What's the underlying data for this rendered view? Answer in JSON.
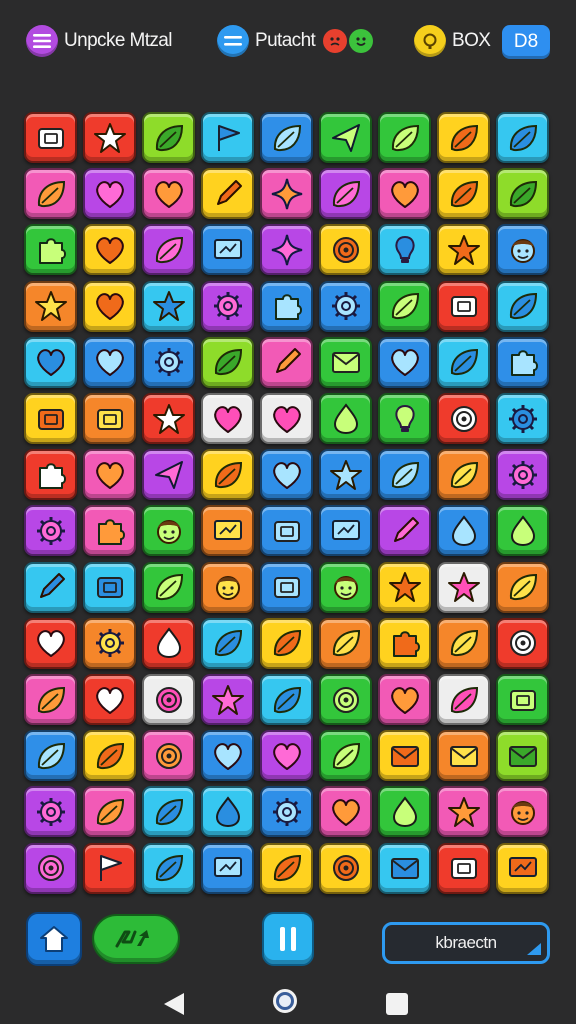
{
  "header": {
    "left_label": "Unpcke Mtzal",
    "middle_label": "Putacht",
    "coins_label": "BOX",
    "level_label": "D8"
  },
  "colors": {
    "red": "#ef3b2c",
    "yellow": "#ffd21f",
    "green": "#33c63b",
    "blue": "#2f8fe8",
    "cyan": "#36c7f0",
    "pink": "#f25ab6",
    "purple": "#b847e6",
    "orange": "#f5862a",
    "lime": "#8edc2a",
    "white": "#eeeeee",
    "lightgreen": "#9ce65a",
    "magenta": "#e448e0"
  },
  "board": {
    "rows": [
      [
        [
          "red",
          "box"
        ],
        [
          "red",
          "star"
        ],
        [
          "lime",
          "leaf"
        ],
        [
          "cyan",
          "flag"
        ],
        [
          "blue",
          "leaf"
        ],
        [
          "green",
          "arrow"
        ],
        [
          "green",
          "leaf"
        ],
        [
          "yellow",
          "leaf"
        ],
        [
          "cyan",
          "leaf"
        ]
      ],
      [
        [
          "pink",
          "leaf"
        ],
        [
          "purple",
          "heart"
        ],
        [
          "pink",
          "heart"
        ],
        [
          "yellow",
          "pen"
        ],
        [
          "pink",
          "star4"
        ],
        [
          "purple",
          "leaf"
        ],
        [
          "pink",
          "heart"
        ],
        [
          "yellow",
          "leaf"
        ],
        [
          "lime",
          "leaf"
        ]
      ],
      [
        [
          "green",
          "puzzle"
        ],
        [
          "yellow",
          "heart"
        ],
        [
          "purple",
          "leaf"
        ],
        [
          "blue",
          "screen"
        ],
        [
          "purple",
          "star4"
        ],
        [
          "yellow",
          "target"
        ],
        [
          "cyan",
          "bulb"
        ],
        [
          "yellow",
          "star"
        ],
        [
          "blue",
          "face"
        ]
      ],
      [
        [
          "orange",
          "star"
        ],
        [
          "yellow",
          "heart"
        ],
        [
          "cyan",
          "star"
        ],
        [
          "purple",
          "gear"
        ],
        [
          "blue",
          "puzzle"
        ],
        [
          "blue",
          "gear"
        ],
        [
          "green",
          "leaf"
        ],
        [
          "red",
          "box"
        ],
        [
          "cyan",
          "leaf"
        ]
      ],
      [
        [
          "cyan",
          "heart"
        ],
        [
          "blue",
          "heart"
        ],
        [
          "blue",
          "gear"
        ],
        [
          "lime",
          "leaf"
        ],
        [
          "pink",
          "pen"
        ],
        [
          "green",
          "mail"
        ],
        [
          "blue",
          "heart"
        ],
        [
          "cyan",
          "leaf"
        ],
        [
          "blue",
          "puzzle"
        ]
      ],
      [
        [
          "yellow",
          "box"
        ],
        [
          "orange",
          "box"
        ],
        [
          "red",
          "star"
        ],
        [
          "white",
          "heart"
        ],
        [
          "white",
          "heart"
        ],
        [
          "green",
          "drop"
        ],
        [
          "green",
          "bulb"
        ],
        [
          "red",
          "target"
        ],
        [
          "cyan",
          "gear"
        ]
      ],
      [
        [
          "red",
          "puzzle"
        ],
        [
          "pink",
          "heart"
        ],
        [
          "purple",
          "arrow"
        ],
        [
          "yellow",
          "leaf"
        ],
        [
          "blue",
          "heart"
        ],
        [
          "blue",
          "star"
        ],
        [
          "blue",
          "leaf"
        ],
        [
          "orange",
          "leaf"
        ],
        [
          "purple",
          "gear"
        ]
      ],
      [
        [
          "purple",
          "gear"
        ],
        [
          "pink",
          "puzzle"
        ],
        [
          "green",
          "face"
        ],
        [
          "orange",
          "screen"
        ],
        [
          "blue",
          "box"
        ],
        [
          "blue",
          "screen"
        ],
        [
          "purple",
          "pen"
        ],
        [
          "blue",
          "drop"
        ],
        [
          "green",
          "drop"
        ]
      ],
      [
        [
          "cyan",
          "pen"
        ],
        [
          "cyan",
          "box"
        ],
        [
          "green",
          "leaf"
        ],
        [
          "orange",
          "face"
        ],
        [
          "blue",
          "box"
        ],
        [
          "green",
          "face"
        ],
        [
          "yellow",
          "star"
        ],
        [
          "white",
          "star"
        ],
        [
          "orange",
          "leaf"
        ]
      ],
      [
        [
          "red",
          "heart"
        ],
        [
          "orange",
          "gear"
        ],
        [
          "red",
          "drop"
        ],
        [
          "cyan",
          "leaf"
        ],
        [
          "yellow",
          "leaf"
        ],
        [
          "orange",
          "leaf"
        ],
        [
          "yellow",
          "puzzle"
        ],
        [
          "orange",
          "leaf"
        ],
        [
          "red",
          "target"
        ]
      ],
      [
        [
          "pink",
          "leaf"
        ],
        [
          "red",
          "heart"
        ],
        [
          "white",
          "target"
        ],
        [
          "purple",
          "star"
        ],
        [
          "cyan",
          "leaf"
        ],
        [
          "green",
          "target"
        ],
        [
          "pink",
          "heart"
        ],
        [
          "white",
          "leaf"
        ],
        [
          "green",
          "box"
        ]
      ],
      [
        [
          "blue",
          "leaf"
        ],
        [
          "yellow",
          "leaf"
        ],
        [
          "pink",
          "target"
        ],
        [
          "blue",
          "heart"
        ],
        [
          "purple",
          "heart"
        ],
        [
          "green",
          "leaf"
        ],
        [
          "yellow",
          "mail"
        ],
        [
          "orange",
          "mail"
        ],
        [
          "lime",
          "mail"
        ]
      ],
      [
        [
          "purple",
          "gear"
        ],
        [
          "pink",
          "leaf"
        ],
        [
          "cyan",
          "leaf"
        ],
        [
          "cyan",
          "drop"
        ],
        [
          "blue",
          "gear"
        ],
        [
          "pink",
          "heart"
        ],
        [
          "green",
          "drop"
        ],
        [
          "pink",
          "star"
        ],
        [
          "pink",
          "face"
        ]
      ],
      [
        [
          "purple",
          "target"
        ],
        [
          "red",
          "flag"
        ],
        [
          "cyan",
          "leaf"
        ],
        [
          "blue",
          "screen"
        ],
        [
          "yellow",
          "leaf"
        ],
        [
          "yellow",
          "target"
        ],
        [
          "cyan",
          "mail"
        ],
        [
          "red",
          "box"
        ],
        [
          "yellow",
          "screen"
        ]
      ]
    ]
  },
  "footer": {
    "score_label": "kbraectn"
  }
}
